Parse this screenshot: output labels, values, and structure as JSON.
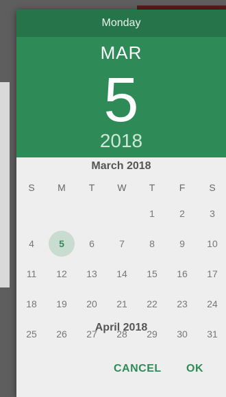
{
  "header": {
    "weekday": "Monday",
    "month": "MAR",
    "day": "5",
    "year": "2018"
  },
  "calendar": {
    "title": "March 2018",
    "weekdays": [
      "S",
      "M",
      "T",
      "W",
      "T",
      "F",
      "S"
    ],
    "weeks": [
      [
        "",
        "",
        "",
        "",
        "1",
        "2",
        "3"
      ],
      [
        "4",
        "5",
        "6",
        "7",
        "8",
        "9",
        "10"
      ],
      [
        "11",
        "12",
        "13",
        "14",
        "15",
        "16",
        "17"
      ],
      [
        "18",
        "19",
        "20",
        "21",
        "22",
        "23",
        "24"
      ],
      [
        "25",
        "26",
        "27",
        "28",
        "29",
        "30",
        "31"
      ]
    ],
    "selected": "5",
    "next_title": "April 2018"
  },
  "actions": {
    "cancel_label": "CANCEL",
    "ok_label": "OK"
  },
  "colors": {
    "accent": "#2e8b57",
    "header_dark": "#25744a",
    "selected_bg": "#c8dccf"
  }
}
